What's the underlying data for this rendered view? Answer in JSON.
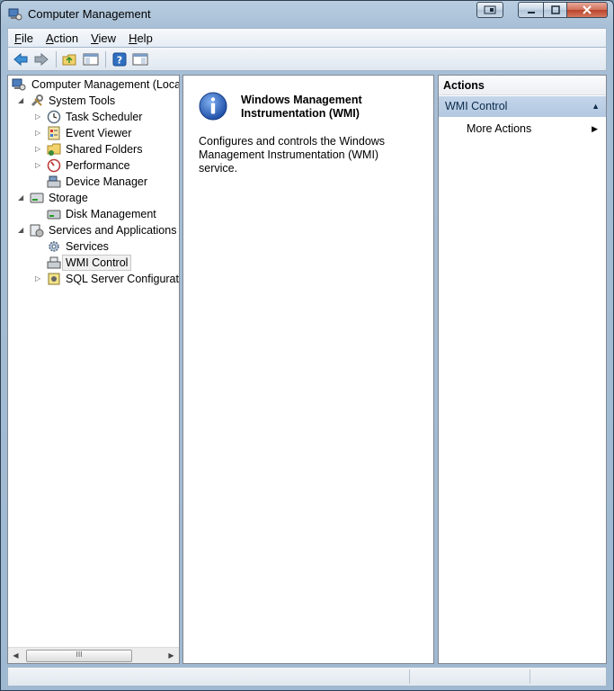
{
  "window": {
    "title": "Computer Management",
    "icon": "computer-management-icon"
  },
  "caption_buttons": [
    "snap-icon",
    "minimize-icon",
    "maximize-icon",
    "close-icon"
  ],
  "menu": [
    {
      "accel": "F",
      "rest": "ile"
    },
    {
      "accel": "A",
      "rest": "ction"
    },
    {
      "accel": "V",
      "rest": "iew"
    },
    {
      "accel": "H",
      "rest": "elp"
    }
  ],
  "toolbar": {
    "buttons": [
      "back-arrow-icon",
      "forward-arrow-icon",
      "up-folder-icon",
      "show-hide-tree-icon",
      "help-icon",
      "show-hide-action-pane-icon"
    ]
  },
  "tree": {
    "root": "Computer Management (Local",
    "system_tools": "System Tools",
    "task_scheduler": "Task Scheduler",
    "event_viewer": "Event Viewer",
    "shared_folders": "Shared Folders",
    "performance": "Performance",
    "device_manager": "Device Manager",
    "storage": "Storage",
    "disk_management": "Disk Management",
    "services_apps": "Services and Applications",
    "services": "Services",
    "wmi_control": "WMI Control",
    "sql_server": "SQL Server Configuratio",
    "scroll_thumb_grip": "III"
  },
  "center": {
    "title": "Windows Management Instrumentation (WMI)",
    "description": "Configures and controls the Windows Management Instrumentation (WMI) service."
  },
  "actions": {
    "header": "Actions",
    "section": "WMI Control",
    "more_actions": "More Actions"
  },
  "colors": {
    "selection_bg": "#c4d5e9",
    "info_icon_blue": "#2a5fbd"
  }
}
